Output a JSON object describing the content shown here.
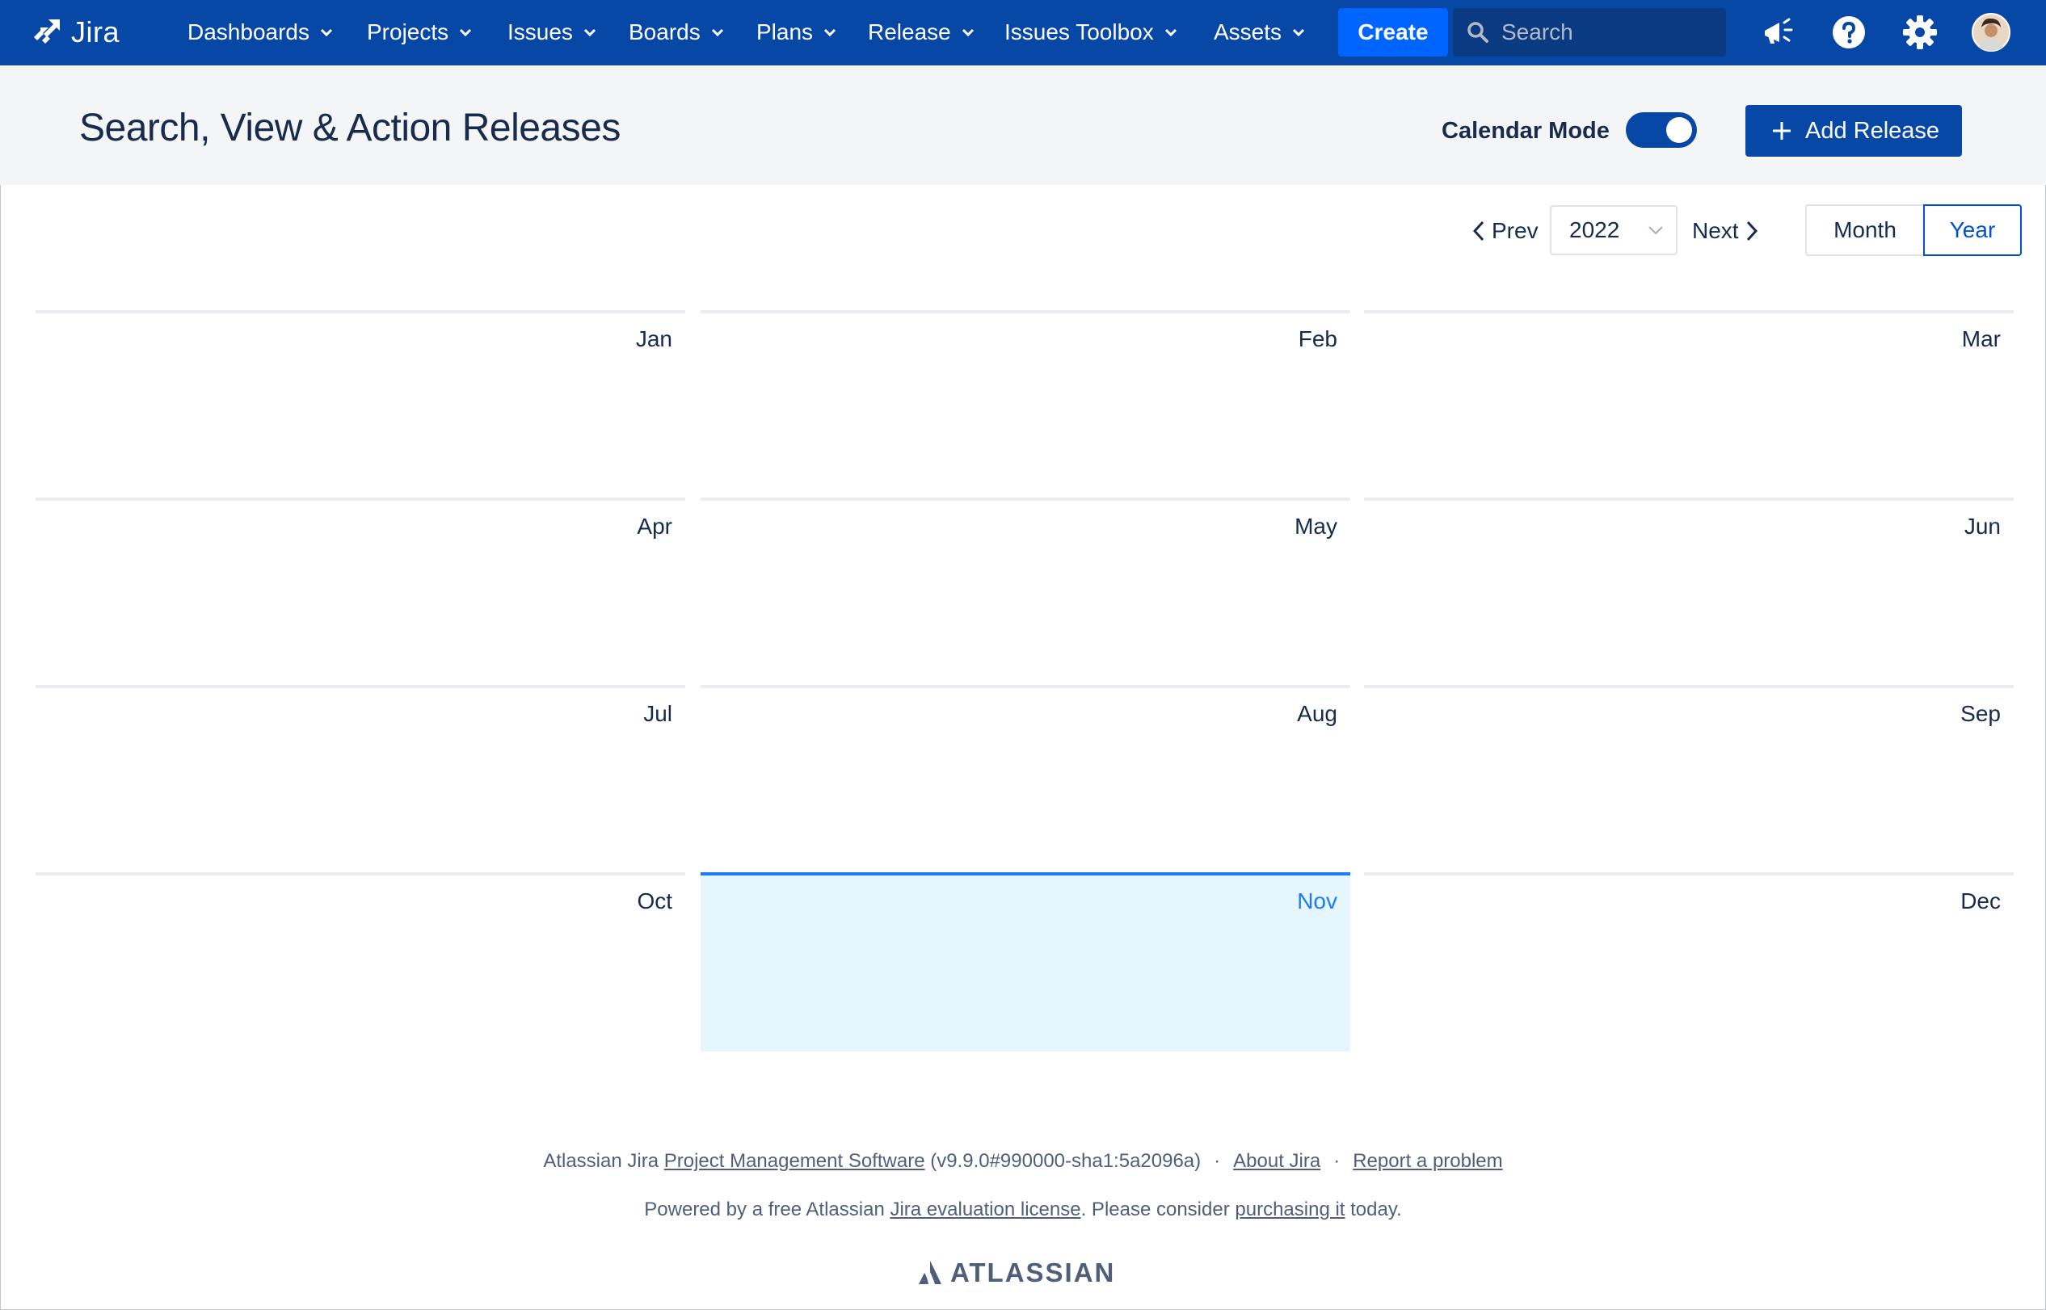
{
  "nav": {
    "logo_text": "Jira",
    "items": [
      {
        "label": "Dashboards"
      },
      {
        "label": "Projects"
      },
      {
        "label": "Issues"
      },
      {
        "label": "Boards"
      },
      {
        "label": "Plans"
      },
      {
        "label": "Release"
      },
      {
        "label": "Issues Toolbox"
      },
      {
        "label": "Assets"
      }
    ],
    "create_label": "Create",
    "search_placeholder": "Search",
    "icons": [
      "megaphone-icon",
      "help-icon",
      "settings-icon",
      "avatar"
    ]
  },
  "header": {
    "title": "Search, View & Action Releases",
    "calendar_mode_label": "Calendar Mode",
    "calendar_mode_on": true,
    "add_release_label": "Add Release"
  },
  "calendar": {
    "prev_label": "Prev",
    "next_label": "Next",
    "year": "2022",
    "views": {
      "month": "Month",
      "year": "Year"
    },
    "active_view": "Year",
    "current_month": "Nov",
    "months": [
      "Jan",
      "Feb",
      "Mar",
      "Apr",
      "May",
      "Jun",
      "Jul",
      "Aug",
      "Sep",
      "Oct",
      "Nov",
      "Dec"
    ]
  },
  "footer": {
    "line1_prefix": "Atlassian Jira ",
    "line1_link": "Project Management Software",
    "line1_version": " (v9.9.0#990000-sha1:5a2096a)",
    "about": "About Jira",
    "report": "Report a problem",
    "line2_prefix": "Powered by a free Atlassian ",
    "line2_link1": "Jira evaluation license",
    "line2_mid": ". Please consider ",
    "line2_link2": "purchasing it",
    "line2_suffix": " today.",
    "brand": "ATLASSIAN"
  },
  "colors": {
    "nav_bg": "#0747a6",
    "create_bg": "#0065ff",
    "current_month_bg": "#e6f6fe",
    "current_month_accent": "#1d7afc"
  }
}
